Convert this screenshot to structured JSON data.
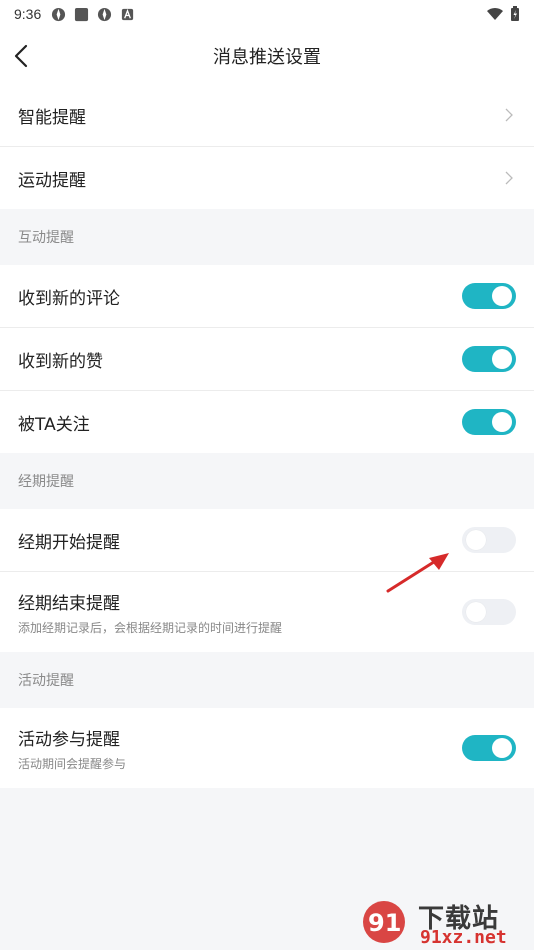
{
  "status_bar": {
    "time": "9:36"
  },
  "header": {
    "title": "消息推送设置"
  },
  "top_items": [
    {
      "label": "智能提醒"
    },
    {
      "label": "运动提醒"
    }
  ],
  "sections": [
    {
      "title": "互动提醒",
      "items": [
        {
          "label": "收到新的评论",
          "toggle": "on"
        },
        {
          "label": "收到新的赞",
          "toggle": "on"
        },
        {
          "label": "被TA关注",
          "toggle": "on"
        }
      ]
    },
    {
      "title": "经期提醒",
      "items": [
        {
          "label": "经期开始提醒",
          "toggle": "off"
        },
        {
          "label": "经期结束提醒",
          "sublabel": "添加经期记录后，会根据经期记录的时间进行提醒",
          "toggle": "off"
        }
      ]
    },
    {
      "title": "活动提醒",
      "items": [
        {
          "label": "活动参与提醒",
          "sublabel": "活动期间会提醒参与",
          "toggle": "on"
        }
      ]
    }
  ],
  "colors": {
    "accent": "#1fb5c4",
    "background": "#f5f6f8",
    "annotation_arrow": "#d62a2a"
  },
  "watermark": {
    "text": "下载站",
    "url": "91xz.net",
    "logo": "91"
  }
}
